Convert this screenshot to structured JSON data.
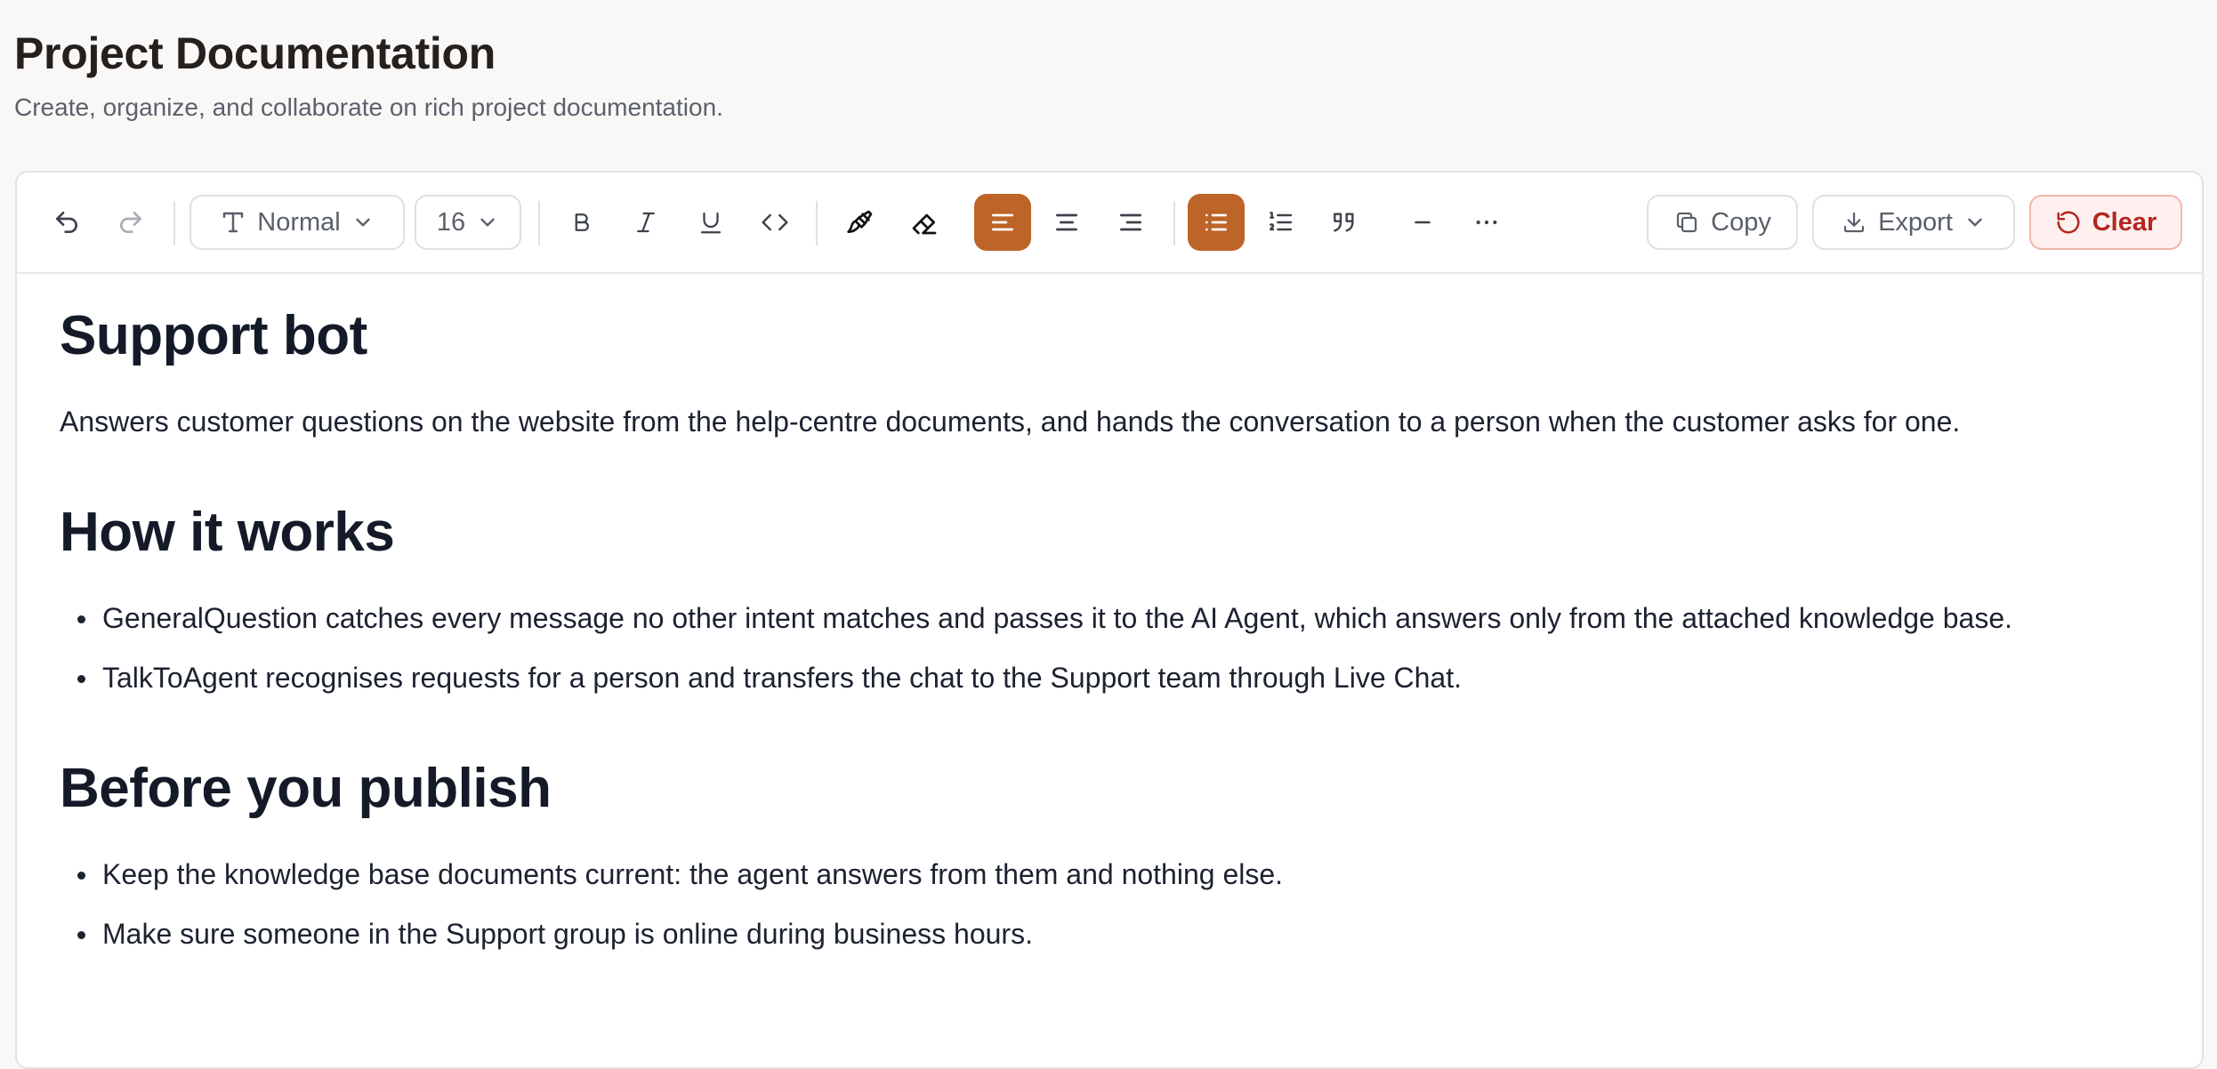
{
  "page": {
    "title": "Project Documentation",
    "subtitle": "Create, organize, and collaborate on rich project documentation."
  },
  "toolbar": {
    "block_style": "Normal",
    "font_size": "16",
    "copy_label": "Copy",
    "export_label": "Export",
    "clear_label": "Clear",
    "active_alignment": "left",
    "active_list": "bullet",
    "colors": {
      "accent": "#bd6428",
      "danger": "#b3261e",
      "danger_bg": "#fdf0ee"
    }
  },
  "document": {
    "title": "Support bot",
    "intro": "Answers customer questions on the website from the help-centre documents, and hands the conversation to a person when the customer asks for one.",
    "sections": [
      {
        "heading": "How it works",
        "bullets": [
          "GeneralQuestion catches every message no other intent matches and passes it to the AI Agent, which answers only from the attached knowledge base.",
          "TalkToAgent recognises requests for a person and transfers the chat to the Support team through Live Chat."
        ]
      },
      {
        "heading": "Before you publish",
        "bullets": [
          "Keep the knowledge base documents current: the agent answers from them and nothing else.",
          "Make sure someone in the Support group is online during business hours."
        ]
      }
    ]
  }
}
